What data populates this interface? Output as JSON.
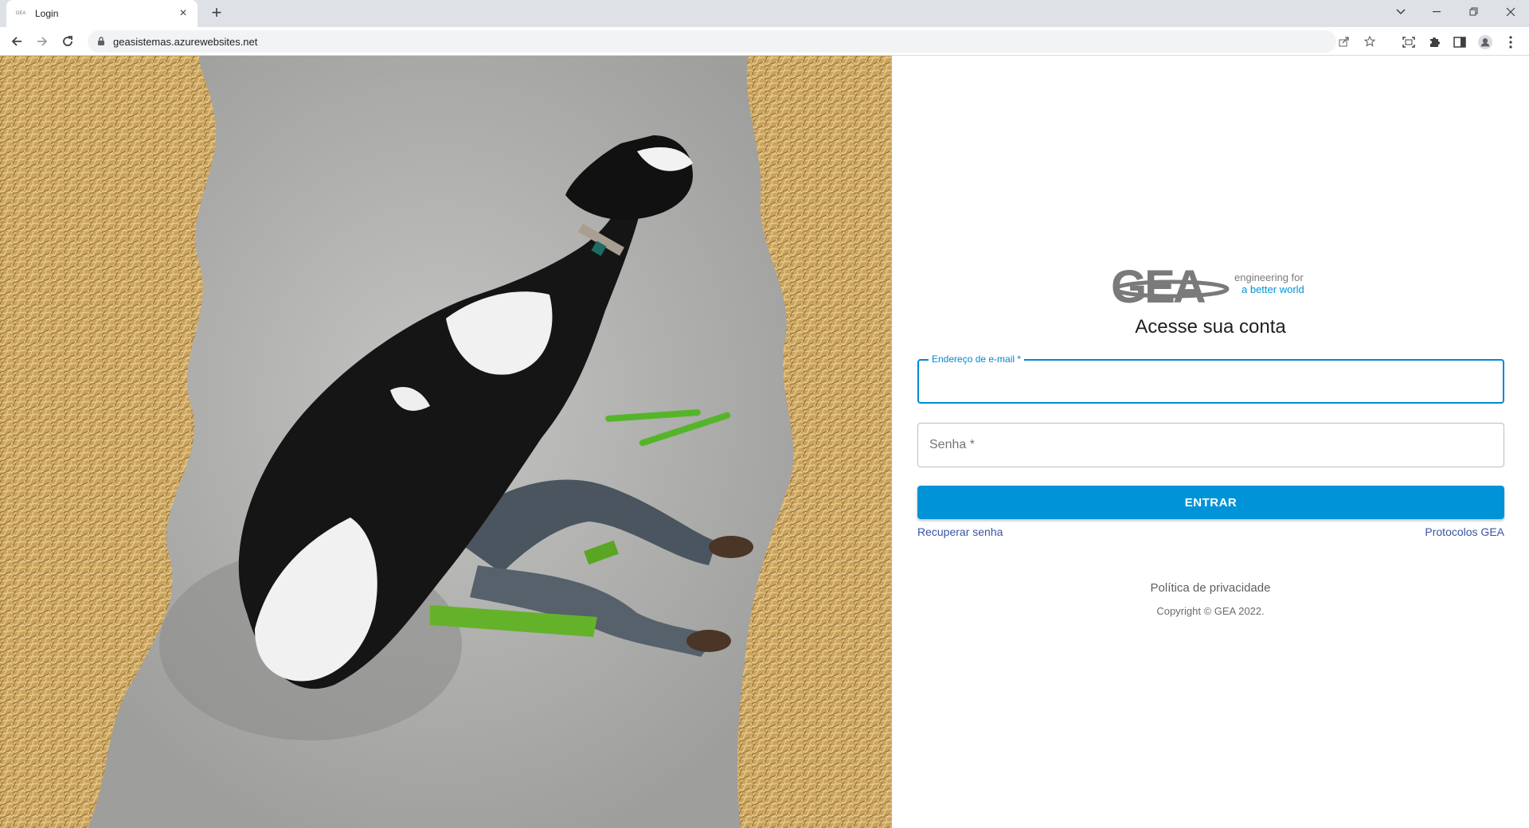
{
  "browser": {
    "tab_title": "Login",
    "favicon_text": "GEA",
    "url": "geasistemas.azurewebsites.net"
  },
  "logo": {
    "wordmark": "GEA",
    "tagline_line1": "engineering for",
    "tagline_line2": "a better world"
  },
  "login": {
    "heading": "Acesse sua conta",
    "email_label": "Endereço de e-mail *",
    "password_label": "Senha *",
    "submit_label": "ENTRAR",
    "recover_link": "Recuperar senha",
    "protocols_link": "Protocolos GEA",
    "privacy_link": "Política de privacidade",
    "copyright": "Copyright © GEA 2022."
  },
  "colors": {
    "primary": "#0093d8",
    "link": "#3a53a4",
    "focus_border": "#0288d1",
    "logo_gray": "#7a7a7a",
    "logo_blue": "#0093d8"
  },
  "icons": {
    "back": "back-arrow-icon",
    "forward": "forward-arrow-icon",
    "reload": "reload-icon",
    "lock": "lock-icon",
    "share": "share-icon",
    "bookmark": "star-icon",
    "screenshot": "screen-capture-icon",
    "extensions": "puzzle-icon",
    "sidepanel": "side-panel-icon",
    "profile": "profile-avatar-icon",
    "menu": "kebab-menu-icon"
  }
}
